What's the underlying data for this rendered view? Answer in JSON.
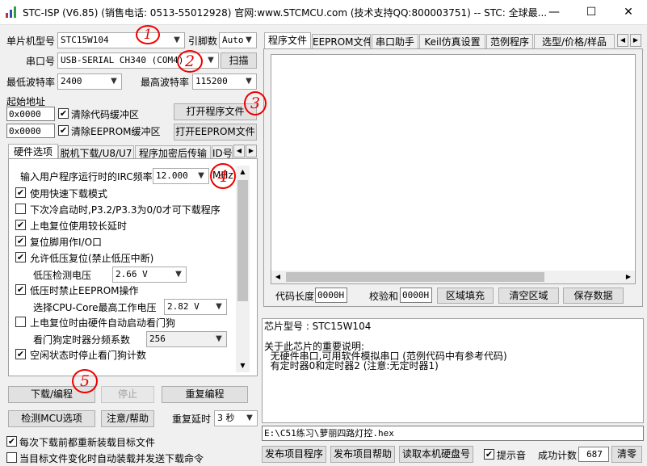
{
  "window": {
    "title": "STC-ISP (V6.85) (销售电话: 0513-55012928) 官网:www.STCMCU.com  (技术支持QQ:800003751)  -- STC: 全球最...",
    "minimize": "—",
    "maximize": "☐",
    "close": "✕"
  },
  "left": {
    "mcu_label": "单片机型号",
    "mcu_value": "STC15W104",
    "pins_label": "引脚数",
    "pins_value": "Auto",
    "port_label": "串口号",
    "port_value": "USB-SERIAL CH340 (COM4)",
    "scan_button": "扫描",
    "min_baud_label": "最低波特率",
    "min_baud_value": "2400",
    "max_baud_label": "最高波特率",
    "max_baud_value": "115200",
    "start_addr_label": "起始地址",
    "addr1_value": "0x0000",
    "clear_code_label": "清除代码缓冲区",
    "open_prog_button": "打开程序文件",
    "addr2_value": "0x0000",
    "clear_eeprom_label": "清除EEPROM缓冲区",
    "open_eeprom_button": "打开EEPROM文件",
    "tabs": [
      "硬件选项",
      "脱机下载/U8/U7",
      "程序加密后传输",
      "ID号"
    ],
    "hw": {
      "irc_label": "输入用户程序运行时的IRC频率",
      "irc_value": "12.000",
      "irc_unit": "MHz",
      "options": [
        {
          "label": "使用快速下载模式",
          "checked": true
        },
        {
          "label": "下次冷启动时,P3.2/P3.3为0/0才可下载程序",
          "checked": false
        },
        {
          "label": "上电复位使用较长延时",
          "checked": true
        },
        {
          "label": "复位脚用作I/O口",
          "checked": true
        },
        {
          "label": "允许低压复位(禁止低压中断)",
          "checked": true
        }
      ],
      "lv_label": "低压检测电压",
      "lv_value": "2.66 V",
      "eeprom_lv_label": "低压时禁止EEPROM操作",
      "cpu_core_label": "选择CPU-Core最高工作电压",
      "cpu_core_value": "2.82 V",
      "wdt_label": "上电复位时由硬件自动启动看门狗",
      "wdt_div_label": "看门狗定时器分频系数",
      "wdt_div_value": "256",
      "idle_wdt_label": "空闲状态时停止看门狗计数"
    },
    "download_button": "下载/编程",
    "stop_button": "停止",
    "reprogram_button": "重复编程",
    "detect_button": "检测MCU选项",
    "help_button": "注意/帮助",
    "repeat_delay_label": "重复延时",
    "repeat_delay_value": "3 秒",
    "reload_label": "每次下载前都重新装载目标文件",
    "autoload_label": "当目标文件变化时自动装载并发送下载命令"
  },
  "right": {
    "tabs": [
      "程序文件",
      "EEPROM文件",
      "串口助手",
      "Keil仿真设置",
      "范例程序",
      "选型/价格/样品"
    ],
    "code_len_label": "代码长度",
    "code_len_value": "0000H",
    "checksum_label": "校验和",
    "checksum_value": "0000H",
    "fill_button": "区域填充",
    "clear_button": "清空区域",
    "save_button": "保存数据",
    "info_lines": [
      "芯片型号 : STC15W104",
      "",
      "关于此芯片的重要说明:",
      "  无硬件串口,可用软件模拟串口 (范例代码中有参考代码)",
      "  有定时器0和定时器2 (注意:无定时器1)"
    ],
    "file_path": "E:\\C51练习\\萝丽四路灯控.hex",
    "publish_button": "发布项目程序",
    "publish_help_button": "发布项目帮助",
    "read_disk_button": "读取本机硬盘号",
    "sound_label": "提示音",
    "success_label": "成功计数",
    "success_value": "687",
    "reset_button": "清零"
  },
  "annotations": [
    "1",
    "2",
    "3",
    "4",
    "5"
  ]
}
